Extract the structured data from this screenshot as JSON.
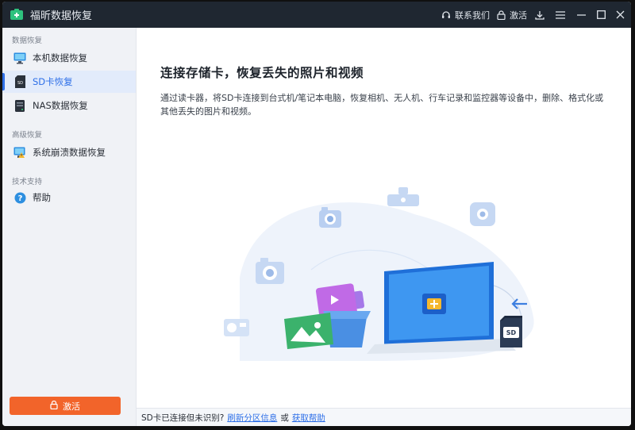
{
  "window": {
    "title": "福昕数据恢复"
  },
  "toolbar": {
    "contact_label": "联系我们",
    "activate_label": "激活"
  },
  "sidebar": {
    "section_recovery": "数据恢复",
    "items": [
      {
        "label": "本机数据恢复",
        "icon": "monitor-icon"
      },
      {
        "label": "SD卡恢复",
        "icon": "sd-card-icon"
      },
      {
        "label": "NAS数据恢复",
        "icon": "nas-icon"
      }
    ],
    "section_advanced": "高级恢复",
    "advanced_items": [
      {
        "label": "系统崩溃数据恢复",
        "icon": "system-crash-icon"
      }
    ],
    "section_support": "技术支持",
    "support_items": [
      {
        "label": "帮助",
        "icon": "help-icon"
      }
    ],
    "activate_button": "激活"
  },
  "main": {
    "heading": "连接存储卡，恢复丢失的照片和视频",
    "description": "通过读卡器，将SD卡连接到台式机/笔记本电脑，恢复相机、无人机、行车记录和监控器等设备中，删除、格式化或其他丢失的图片和视频。",
    "sd_label": "SD"
  },
  "footer": {
    "text": "SD卡已连接但未识别?",
    "link_refresh": "刷新分区信息",
    "or": "或",
    "link_help": "获取帮助"
  },
  "colors": {
    "titlebar": "#1f2731",
    "accent": "#2d6fe8",
    "activate": "#f2642a",
    "sidebar_bg": "#f0f2f6"
  }
}
